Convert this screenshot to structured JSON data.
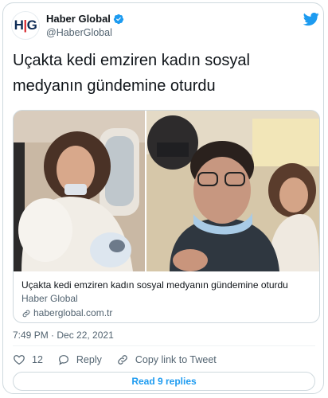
{
  "author": {
    "display_name": "Haber Global",
    "handle": "@HaberGlobal",
    "avatar_text": [
      "H",
      "|",
      "G"
    ]
  },
  "tweet": {
    "text_line1": "Uçakta kedi emziren kadın sosyal",
    "text_line2": "medyanın gündemine oturdu"
  },
  "link_card": {
    "title": "Uçakta kedi emziren kadın sosyal medyanın gündemine oturdu",
    "source": "Haber Global",
    "domain": "haberglobal.com.tr"
  },
  "meta": {
    "timestamp": "7:49 PM · Dec 22, 2021"
  },
  "actions": {
    "like_count": "12",
    "reply_label": "Reply",
    "copy_label": "Copy link to Tweet"
  },
  "read_replies_label": "Read 9 replies",
  "colors": {
    "accent": "#1d9bf0",
    "text": "#0f1419",
    "muted": "#536471",
    "border": "#cfd9de"
  }
}
